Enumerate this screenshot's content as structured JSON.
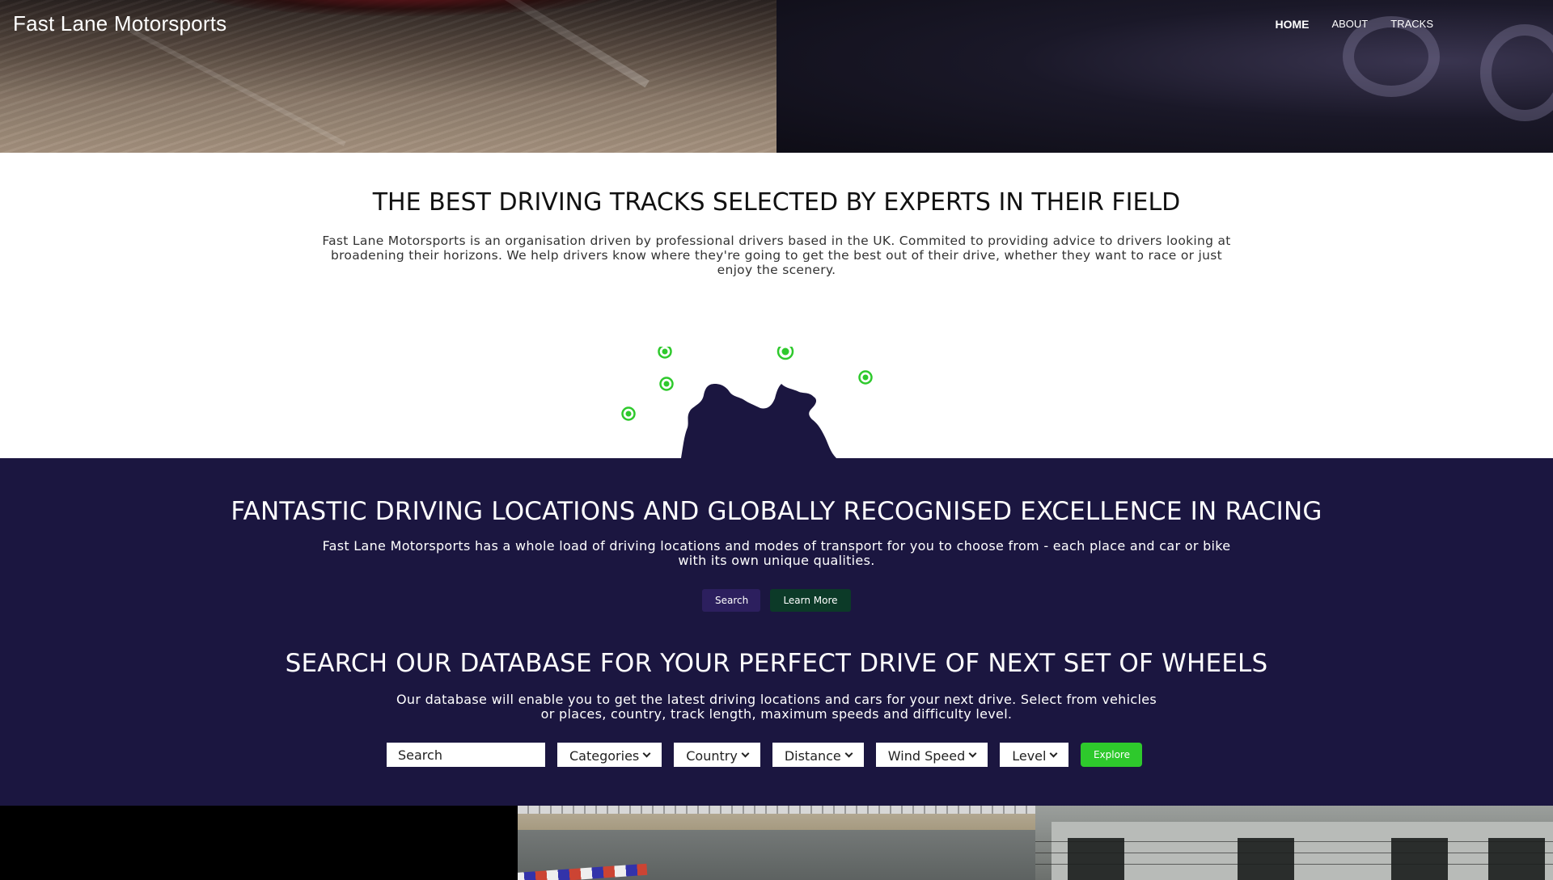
{
  "header": {
    "brand": "Fast Lane Motorsports",
    "nav": [
      {
        "label": "HOME",
        "active": true
      },
      {
        "label": "ABOUT",
        "active": false
      },
      {
        "label": "TRACKS",
        "active": false
      }
    ]
  },
  "intro": {
    "title": "THE BEST DRIVING TRACKS SELECTED BY EXPERTS IN THEIR FIELD",
    "text": "Fast Lane Motorsports is an organisation driven by professional drivers based in the UK. Commited to providing advice to drivers looking at broadening their horizons. We help drivers know where they're going to get the best out of their drive, whether they want to race or just enjoy the scenery.",
    "map": {
      "land_color": "#1b1640",
      "marker_color": "#2ec92c",
      "marker_count": 5
    }
  },
  "feature": {
    "title": "FANTASTIC DRIVING LOCATIONS AND GLOBALLY RECOGNISED EXCELLENCE IN RACING",
    "text": "Fast Lane Motorsports has a whole load of driving locations and modes of transport for you to choose from - each place and car or bike with its own unique qualities.",
    "search_button": "Search",
    "learn_more_button": "Learn More"
  },
  "database": {
    "title": "SEARCH OUR DATABASE FOR YOUR PERFECT DRIVE OF NEXT SET OF WHEELS",
    "text": "Our database will enable you to get the latest driving locations and cars for your next drive. Select from vehicles or places, country, track length, maximum speeds and difficulty level.",
    "search_placeholder": "Search",
    "filters": [
      "Categories",
      "Country",
      "Distance",
      "Wind Speed",
      "Level"
    ],
    "explore_button": "Explore"
  },
  "colors": {
    "section_dark": "#1b1640",
    "accent_green": "#2ec92c",
    "button_purple": "#2c1f5e",
    "button_dark_green": "#0c3a28"
  }
}
